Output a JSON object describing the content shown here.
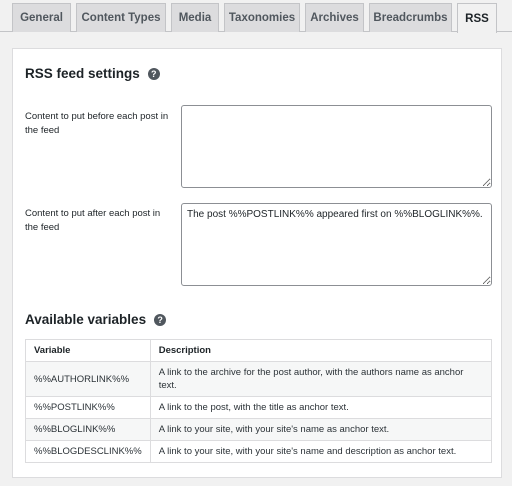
{
  "tabs": [
    "General",
    "Content Types",
    "Media",
    "Taxonomies",
    "Archives",
    "Breadcrumbs",
    "RSS"
  ],
  "active_tab": "RSS",
  "rss": {
    "title": "RSS feed settings",
    "before_label": "Content to put before each post in the feed",
    "before_value": "",
    "after_label": "Content to put after each post in the feed",
    "after_value": "The post %%POSTLINK%% appeared first on %%BLOGLINK%%."
  },
  "variables": {
    "title": "Available variables",
    "header_variable": "Variable",
    "header_description": "Description",
    "rows": [
      {
        "variable": "%%AUTHORLINK%%",
        "description": "A link to the archive for the post author, with the authors name as anchor text."
      },
      {
        "variable": "%%POSTLINK%%",
        "description": "A link to the post, with the title as anchor text."
      },
      {
        "variable": "%%BLOGLINK%%",
        "description": "A link to your site, with your site's name as anchor text."
      },
      {
        "variable": "%%BLOGDESCLINK%%",
        "description": "A link to your site, with your site's name and description as anchor text."
      }
    ]
  },
  "icons": {
    "help": "help-circle-icon"
  },
  "colors": {
    "panel": "#ffffff",
    "background": "#f1f1f1",
    "tab_inactive": "#dcdcde",
    "border": "#c3c4c7"
  }
}
